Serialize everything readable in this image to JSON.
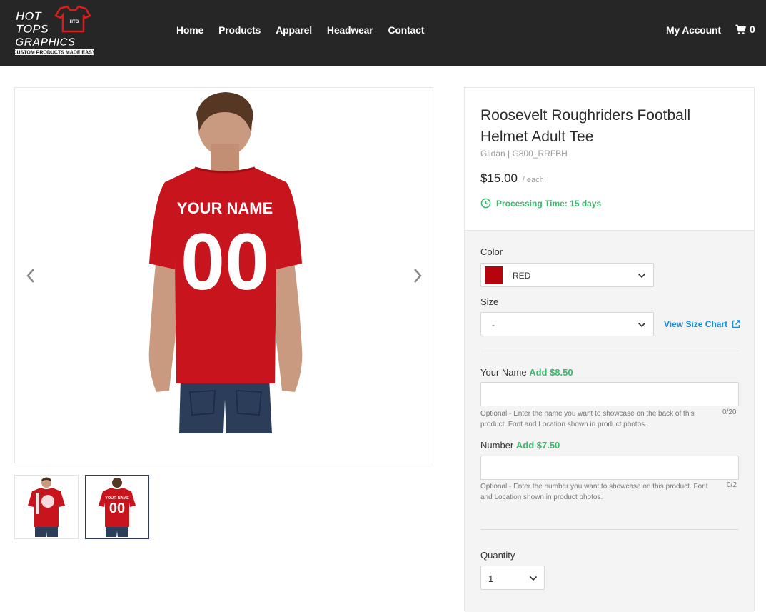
{
  "header": {
    "logo": {
      "line1": "HOT",
      "line2": "TOPS",
      "line3": "GRAPHICS",
      "tagline": "CUSTOM PRODUCTS MADE EASY",
      "badge": "HTG"
    },
    "nav": [
      "Home",
      "Products",
      "Apparel",
      "Headwear",
      "Contact"
    ],
    "account_label": "My Account",
    "cart_count": "0"
  },
  "gallery": {
    "main_image": {
      "print_name": "YOUR NAME",
      "print_number": "00"
    },
    "thumbnails": [
      {
        "kind": "front"
      },
      {
        "kind": "back",
        "print_name": "YOUR NAME",
        "print_number": "00"
      }
    ],
    "active_thumbnail": 1,
    "shirt_color": "#c8141d"
  },
  "product": {
    "title": "Roosevelt Roughriders Football Helmet Adult Tee",
    "sku": "Gildan | G800_RRFBH",
    "price": "$15.00",
    "price_unit": "/ each",
    "processing_time": "Processing Time: 15 days"
  },
  "options": {
    "color_label": "Color",
    "color_value": "RED",
    "color_swatch": "#b5040e",
    "size_label": "Size",
    "size_value": "-",
    "size_chart_link": "View Size Chart",
    "name_label": "Your Name",
    "name_add": "Add $8.50",
    "name_help": "Optional - Enter the name you want to showcase on the back of this product. Font and Location shown in product photos.",
    "name_count": "0/20",
    "number_label": "Number",
    "number_add": "Add $7.50",
    "number_help": "Optional - Enter the number you want to showcase on this product. Font and Location shown in product photos.",
    "number_count": "0/2",
    "quantity_label": "Quantity",
    "quantity_value": "1"
  },
  "colors": {
    "header_bg": "#262626",
    "accent_green": "#3ab86b",
    "link_blue": "#1a8cd8"
  }
}
